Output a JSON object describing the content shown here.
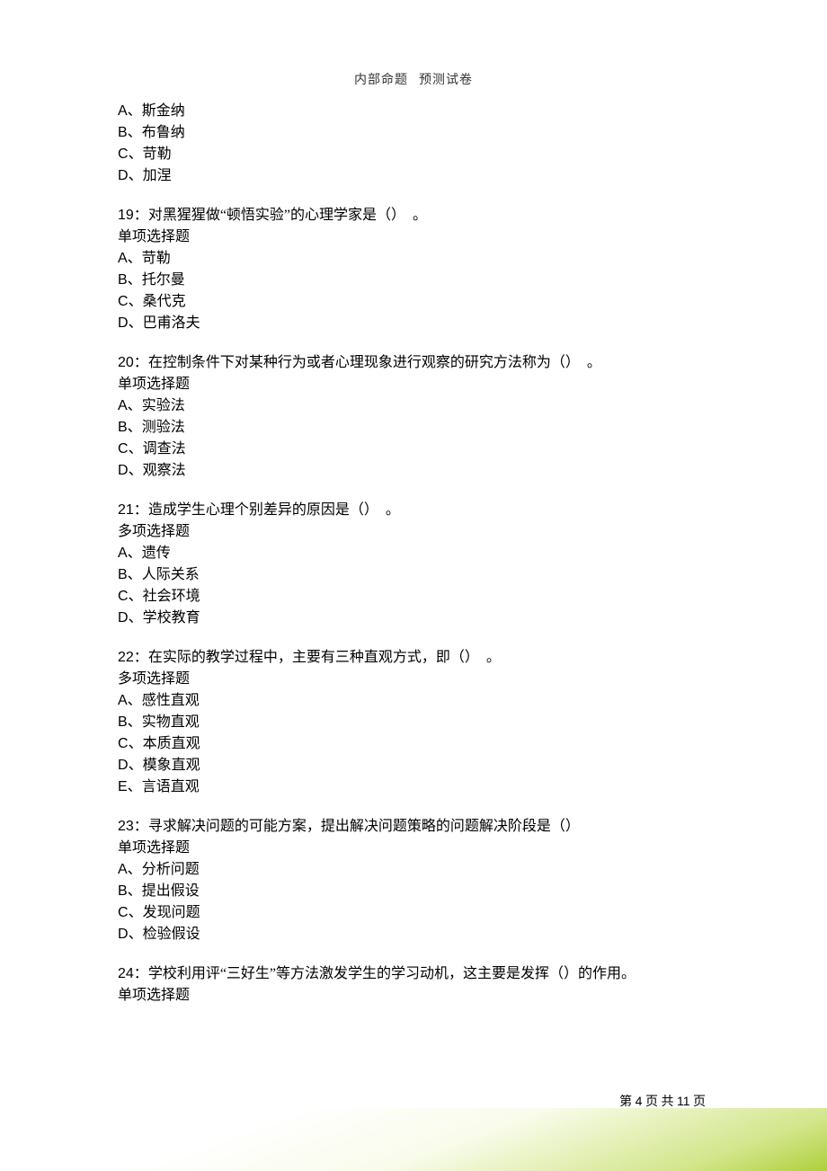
{
  "header": {
    "left": "内部命题",
    "right": "预测试卷"
  },
  "q18_tail": {
    "opts": [
      {
        "letter": "A",
        "text": "斯金纳"
      },
      {
        "letter": "B",
        "text": "布鲁纳"
      },
      {
        "letter": "C",
        "text": "苛勒"
      },
      {
        "letter": "D",
        "text": "加涅"
      }
    ]
  },
  "questions": [
    {
      "num": "19",
      "stem": "对黑猩猩做“顿悟实验”的心理学家是（）　。",
      "qtype": "单项选择题",
      "opts": [
        {
          "letter": "A",
          "text": "苛勒"
        },
        {
          "letter": "B",
          "text": "托尔曼"
        },
        {
          "letter": "C",
          "text": "桑代克"
        },
        {
          "letter": "D",
          "text": "巴甫洛夫"
        }
      ]
    },
    {
      "num": "20",
      "stem": "在控制条件下对某种行为或者心理现象进行观察的研究方法称为（）　。",
      "qtype": "单项选择题",
      "opts": [
        {
          "letter": "A",
          "text": "实验法"
        },
        {
          "letter": "B",
          "text": "测验法"
        },
        {
          "letter": "C",
          "text": "调查法"
        },
        {
          "letter": "D",
          "text": "观察法"
        }
      ]
    },
    {
      "num": "21",
      "stem": "造成学生心理个别差异的原因是（）　。",
      "qtype": "多项选择题",
      "opts": [
        {
          "letter": "A",
          "text": "遗传"
        },
        {
          "letter": "B",
          "text": "人际关系"
        },
        {
          "letter": "C",
          "text": "社会环境"
        },
        {
          "letter": "D",
          "text": "学校教育"
        }
      ]
    },
    {
      "num": "22",
      "stem": "在实际的教学过程中，主要有三种直观方式，即（）　。",
      "qtype": "多项选择题",
      "opts": [
        {
          "letter": "A",
          "text": "感性直观"
        },
        {
          "letter": "B",
          "text": "实物直观"
        },
        {
          "letter": "C",
          "text": "本质直观"
        },
        {
          "letter": "D",
          "text": "模象直观"
        },
        {
          "letter": "E",
          "text": "言语直观"
        }
      ]
    },
    {
      "num": "23",
      "stem": "寻求解决问题的可能方案，提出解决问题策略的问题解决阶段是（）",
      "qtype": "单项选择题",
      "opts": [
        {
          "letter": "A",
          "text": "分析问题"
        },
        {
          "letter": "B",
          "text": "提出假设"
        },
        {
          "letter": "C",
          "text": "发现问题"
        },
        {
          "letter": "D",
          "text": "检验假设"
        }
      ]
    },
    {
      "num": "24",
      "stem": "学校利用评“三好生”等方法激发学生的学习动机，这主要是发挥（）的作用。",
      "qtype": "单项选择题",
      "opts": []
    }
  ],
  "sep": "、",
  "colon": "：",
  "footer": {
    "t1": "第 ",
    "page": "4",
    "t2": " 页 共 ",
    "total": "11",
    "t3": " 页"
  }
}
